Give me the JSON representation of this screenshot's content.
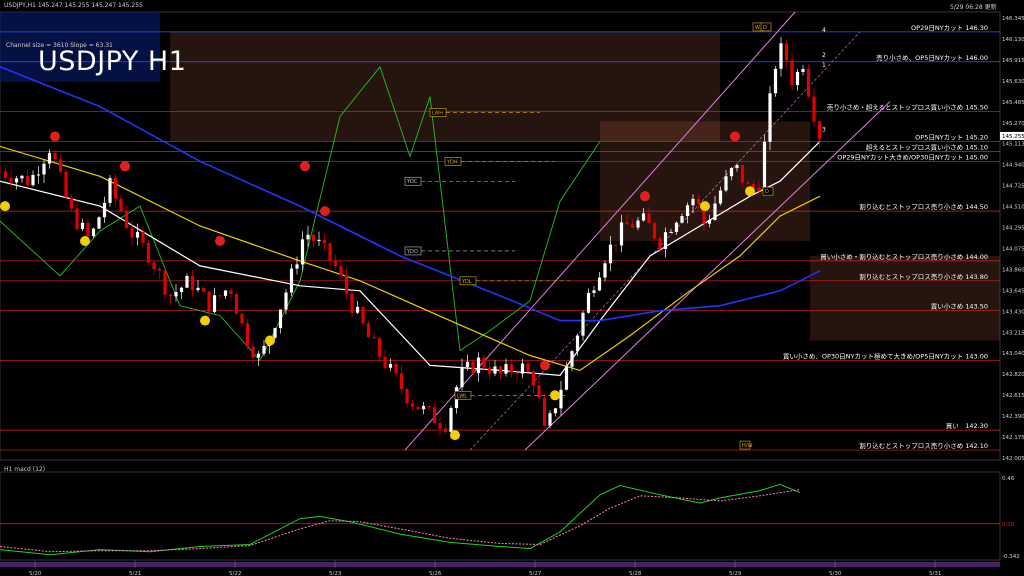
{
  "header": {
    "symbol_info": "USDJPY,H1  145.247 145.255 145.247 145.255",
    "updated": "5/29 06:28 更新",
    "channel_info": "Channel size = 3610  Slope = 63.31",
    "big_title": "USDJPY H1",
    "sub_panel_label": "H1 macd (12)"
  },
  "colors": {
    "background": "#000000",
    "up_candle": "#ffffff",
    "down_candle": "#e00000",
    "ma_fast": "#ffffff",
    "ma_mid": "#e8d000",
    "ma_slow": "#2233ff",
    "channel": "#e080e0",
    "chikou": "#22c022",
    "kumo": "#d07050",
    "level_line": "#e02020",
    "blue_level": "#3355ff"
  },
  "chart_data": {
    "type": "candlestick",
    "price_axis": {
      "ylim": [
        142.0,
        146.5
      ],
      "tick_labels": [
        "146.345",
        "146.130",
        "145.915",
        "145.630",
        "145.485",
        "145.270",
        "145.113",
        "144.940",
        "144.725",
        "144.510",
        "144.295",
        "144.075",
        "143.860",
        "143.645",
        "143.430",
        "143.215",
        "143.040",
        "142.820",
        "142.615",
        "142.390",
        "142.175",
        "142.005"
      ]
    },
    "x_axis": {
      "tick_labels": [
        "5/20",
        "5/21",
        "5/22",
        "5/23",
        "5/26",
        "5/27",
        "5/28",
        "5/29",
        "5/30",
        "5/31"
      ],
      "range": [
        0,
        10
      ]
    },
    "current_price": "145.255",
    "candles_anchor": [
      [
        0.0,
        144.9
      ],
      [
        0.3,
        144.8
      ],
      [
        0.5,
        145.15
      ],
      [
        0.7,
        144.5
      ],
      [
        0.9,
        144.2
      ],
      [
        1.1,
        144.75
      ],
      [
        1.3,
        144.3
      ],
      [
        1.5,
        144.05
      ],
      [
        1.7,
        143.65
      ],
      [
        1.9,
        143.8
      ],
      [
        2.1,
        143.55
      ],
      [
        2.3,
        143.75
      ],
      [
        2.45,
        143.25
      ],
      [
        2.6,
        143.0
      ],
      [
        2.75,
        143.4
      ],
      [
        2.9,
        143.8
      ],
      [
        3.05,
        144.3
      ],
      [
        3.2,
        144.15
      ],
      [
        3.35,
        143.95
      ],
      [
        3.5,
        143.6
      ],
      [
        3.7,
        143.2
      ],
      [
        3.9,
        142.9
      ],
      [
        4.1,
        142.6
      ],
      [
        4.3,
        142.45
      ],
      [
        4.45,
        142.35
      ],
      [
        4.6,
        142.85
      ],
      [
        4.8,
        143.0
      ],
      [
        5.0,
        142.85
      ],
      [
        5.2,
        142.95
      ],
      [
        5.35,
        142.8
      ],
      [
        5.45,
        142.25
      ],
      [
        5.6,
        142.7
      ],
      [
        5.75,
        143.2
      ],
      [
        5.9,
        143.7
      ],
      [
        6.05,
        144.05
      ],
      [
        6.25,
        144.35
      ],
      [
        6.45,
        144.4
      ],
      [
        6.6,
        144.2
      ],
      [
        6.8,
        144.5
      ],
      [
        6.95,
        144.65
      ],
      [
        7.05,
        144.35
      ],
      [
        7.2,
        144.7
      ],
      [
        7.35,
        144.95
      ],
      [
        7.5,
        144.7
      ],
      [
        7.6,
        144.8
      ],
      [
        7.7,
        145.6
      ],
      [
        7.78,
        146.15
      ],
      [
        7.86,
        146.05
      ],
      [
        7.94,
        145.75
      ],
      [
        8.02,
        146.05
      ],
      [
        8.1,
        145.65
      ],
      [
        8.2,
        145.25
      ]
    ],
    "moving_averages": [
      {
        "name": "ma-fast",
        "points": [
          [
            0.0,
            144.8
          ],
          [
            1.0,
            144.55
          ],
          [
            2.0,
            143.95
          ],
          [
            3.0,
            143.75
          ],
          [
            3.6,
            143.7
          ],
          [
            4.3,
            142.95
          ],
          [
            5.0,
            142.9
          ],
          [
            5.6,
            142.85
          ],
          [
            6.0,
            143.4
          ],
          [
            6.5,
            144.05
          ],
          [
            7.0,
            144.35
          ],
          [
            7.5,
            144.65
          ],
          [
            7.8,
            144.8
          ],
          [
            8.2,
            145.2
          ]
        ]
      },
      {
        "name": "ma-mid",
        "points": [
          [
            0.0,
            145.15
          ],
          [
            1.0,
            144.85
          ],
          [
            2.0,
            144.35
          ],
          [
            3.0,
            144.0
          ],
          [
            3.6,
            143.8
          ],
          [
            4.5,
            143.4
          ],
          [
            5.3,
            143.05
          ],
          [
            5.8,
            142.9
          ],
          [
            6.3,
            143.25
          ],
          [
            6.9,
            143.7
          ],
          [
            7.4,
            144.05
          ],
          [
            7.8,
            144.45
          ],
          [
            8.2,
            144.65
          ]
        ]
      },
      {
        "name": "ma-slow",
        "points": [
          [
            0.0,
            145.95
          ],
          [
            1.0,
            145.55
          ],
          [
            2.0,
            145.0
          ],
          [
            3.0,
            144.55
          ],
          [
            4.0,
            144.05
          ],
          [
            5.0,
            143.65
          ],
          [
            5.6,
            143.4
          ],
          [
            6.0,
            143.4
          ],
          [
            6.6,
            143.5
          ],
          [
            7.2,
            143.55
          ],
          [
            7.8,
            143.7
          ],
          [
            8.2,
            143.9
          ]
        ]
      }
    ],
    "chikou": [
      [
        0.0,
        144.4
      ],
      [
        0.6,
        143.85
      ],
      [
        1.0,
        144.3
      ],
      [
        1.4,
        144.55
      ],
      [
        1.8,
        143.55
      ],
      [
        2.2,
        143.45
      ],
      [
        2.6,
        143.0
      ],
      [
        3.0,
        143.8
      ],
      [
        3.4,
        145.45
      ],
      [
        3.8,
        145.95
      ],
      [
        4.1,
        145.05
      ],
      [
        4.3,
        145.65
      ],
      [
        4.6,
        143.1
      ],
      [
        4.9,
        143.3
      ],
      [
        5.3,
        143.6
      ],
      [
        5.6,
        144.6
      ],
      [
        5.8,
        144.9
      ],
      [
        6.0,
        145.2
      ]
    ],
    "channel": {
      "upper": [
        [
          4.05,
          142.1
        ],
        [
          7.95,
          146.5
        ]
      ],
      "lower": [
        [
          5.25,
          142.1
        ],
        [
          8.9,
          145.6
        ]
      ],
      "mid": [
        [
          4.7,
          142.1
        ],
        [
          8.6,
          146.3
        ]
      ]
    },
    "kumo": [
      {
        "x0": 1.7,
        "x1": 7.2,
        "top": 146.3,
        "bottom": 145.2
      },
      {
        "x0": 6.0,
        "x1": 8.1,
        "top": 145.4,
        "bottom": 144.2
      },
      {
        "x0": 8.1,
        "x1": 10.0,
        "top": 144.05,
        "bottom": 143.2
      }
    ],
    "markers_top": [
      {
        "label": "W",
        "x": 7.58,
        "price": 146.35
      },
      {
        "label": "D",
        "x": 7.66,
        "price": 146.35
      },
      {
        "label": "D",
        "x": 7.68,
        "price": 144.7
      },
      {
        "label": "H/W",
        "x": 7.45,
        "price": 142.15
      }
    ],
    "ref_labels": [
      {
        "label": "LWH",
        "x": 4.3,
        "price": 145.49,
        "color": "#e0b000"
      },
      {
        "label": "YDH",
        "x": 4.45,
        "price": 145.0,
        "color": "#e0b000"
      },
      {
        "label": "YDC",
        "x": 4.05,
        "price": 144.8,
        "color": "#c0c0c0"
      },
      {
        "label": "YDO",
        "x": 4.05,
        "price": 144.1,
        "color": "#c0c0c0"
      },
      {
        "label": "YDL",
        "x": 4.6,
        "price": 143.8,
        "color": "#e0b000"
      },
      {
        "label": "LWL",
        "x": 4.55,
        "price": 142.65,
        "color": "#e0b000"
      }
    ],
    "channel_tags": [
      {
        "label": "4",
        "x": 8.22,
        "price": 146.3
      },
      {
        "label": "2",
        "x": 8.22,
        "price": 146.05
      },
      {
        "label": "1",
        "x": 8.22,
        "price": 145.95
      },
      {
        "label": "3",
        "x": 8.22,
        "price": 145.3
      }
    ],
    "levels": [
      {
        "price": 146.3,
        "color": "#3355ff",
        "text": "OP29日NYカット 146.30"
      },
      {
        "price": 146.0,
        "color": "#3355ff",
        "text": "売り小さめ、OP5日NYカット 146.00"
      },
      {
        "price": 145.5,
        "color": "#3355ff",
        "text": "売り小さめ・超えるとストップロス買い小さめ 145.50"
      },
      {
        "price": 145.2,
        "color": "#3355ff",
        "text": "OP5日NYカット 145.20"
      },
      {
        "price": 145.1,
        "color": "#e02020",
        "text": "超えるとストップロス買い小さめ 145.10"
      },
      {
        "price": 145.0,
        "color": "#3355ff",
        "text": "OP29日NYカット大きめ/OP30日NYカット 145.00"
      },
      {
        "price": 144.5,
        "color": "#e02020",
        "text": "割り込むとストップロス売り小さめ 144.50"
      },
      {
        "price": 144.0,
        "color": "#e02020",
        "text": "買い小さめ・割り込むとストップロス売り小さめ 144.00"
      },
      {
        "price": 143.8,
        "color": "#e02020",
        "text": "割り込むとストップロス売り小さめ 143.80"
      },
      {
        "price": 143.5,
        "color": "#e02020",
        "text": "買い小さめ 143.50"
      },
      {
        "price": 143.0,
        "color": "#e02020",
        "text": "買い小さめ、OP30日NYカット極めて大きめ/OP5日NYカット 143.00"
      },
      {
        "price": 142.3,
        "color": "#e02020",
        "text": "買い　142.30"
      },
      {
        "price": 142.1,
        "color": "#e02020",
        "text": "割り込むとストップロス売り小さめ 142.10"
      }
    ],
    "fractal_markers": [
      {
        "x": 0.05,
        "price": 144.55,
        "dir": "up"
      },
      {
        "x": 0.55,
        "price": 145.25,
        "dir": "down"
      },
      {
        "x": 0.85,
        "price": 144.2,
        "dir": "up"
      },
      {
        "x": 1.25,
        "price": 144.95,
        "dir": "down"
      },
      {
        "x": 2.05,
        "price": 143.4,
        "dir": "up"
      },
      {
        "x": 2.2,
        "price": 144.2,
        "dir": "down"
      },
      {
        "x": 2.7,
        "price": 143.2,
        "dir": "up"
      },
      {
        "x": 3.05,
        "price": 144.95,
        "dir": "down"
      },
      {
        "x": 3.25,
        "price": 144.5,
        "dir": "down"
      },
      {
        "x": 4.55,
        "price": 142.25,
        "dir": "up"
      },
      {
        "x": 5.55,
        "price": 142.65,
        "dir": "up"
      },
      {
        "x": 5.45,
        "price": 142.95,
        "dir": "down"
      },
      {
        "x": 6.45,
        "price": 144.65,
        "dir": "down"
      },
      {
        "x": 7.05,
        "price": 144.55,
        "dir": "up"
      },
      {
        "x": 7.35,
        "price": 145.25,
        "dir": "down"
      },
      {
        "x": 7.5,
        "price": 144.7,
        "dir": "up"
      }
    ],
    "macd": {
      "ylim": [
        -0.35,
        0.5
      ],
      "tick_labels": [
        "0.46",
        "0.00",
        "-0.342"
      ],
      "zero": 0.0,
      "main": [
        [
          0.0,
          -0.25
        ],
        [
          0.5,
          -0.3
        ],
        [
          1.0,
          -0.25
        ],
        [
          1.5,
          -0.27
        ],
        [
          2.0,
          -0.22
        ],
        [
          2.5,
          -0.2
        ],
        [
          3.0,
          0.05
        ],
        [
          3.2,
          0.07
        ],
        [
          3.5,
          0.02
        ],
        [
          4.0,
          -0.1
        ],
        [
          4.5,
          -0.18
        ],
        [
          5.0,
          -0.22
        ],
        [
          5.3,
          -0.24
        ],
        [
          5.6,
          -0.08
        ],
        [
          6.0,
          0.28
        ],
        [
          6.2,
          0.37
        ],
        [
          6.6,
          0.28
        ],
        [
          7.0,
          0.2
        ],
        [
          7.2,
          0.25
        ],
        [
          7.6,
          0.32
        ],
        [
          7.8,
          0.38
        ],
        [
          8.0,
          0.3
        ]
      ],
      "signal": [
        [
          0.0,
          -0.22
        ],
        [
          0.5,
          -0.27
        ],
        [
          1.0,
          -0.26
        ],
        [
          1.5,
          -0.26
        ],
        [
          2.0,
          -0.24
        ],
        [
          2.5,
          -0.21
        ],
        [
          3.0,
          -0.05
        ],
        [
          3.3,
          0.03
        ],
        [
          3.6,
          0.02
        ],
        [
          4.0,
          -0.05
        ],
        [
          4.5,
          -0.14
        ],
        [
          5.0,
          -0.19
        ],
        [
          5.4,
          -0.2
        ],
        [
          5.8,
          -0.02
        ],
        [
          6.1,
          0.15
        ],
        [
          6.4,
          0.27
        ],
        [
          6.8,
          0.25
        ],
        [
          7.2,
          0.22
        ],
        [
          7.6,
          0.27
        ],
        [
          8.0,
          0.33
        ]
      ]
    }
  }
}
